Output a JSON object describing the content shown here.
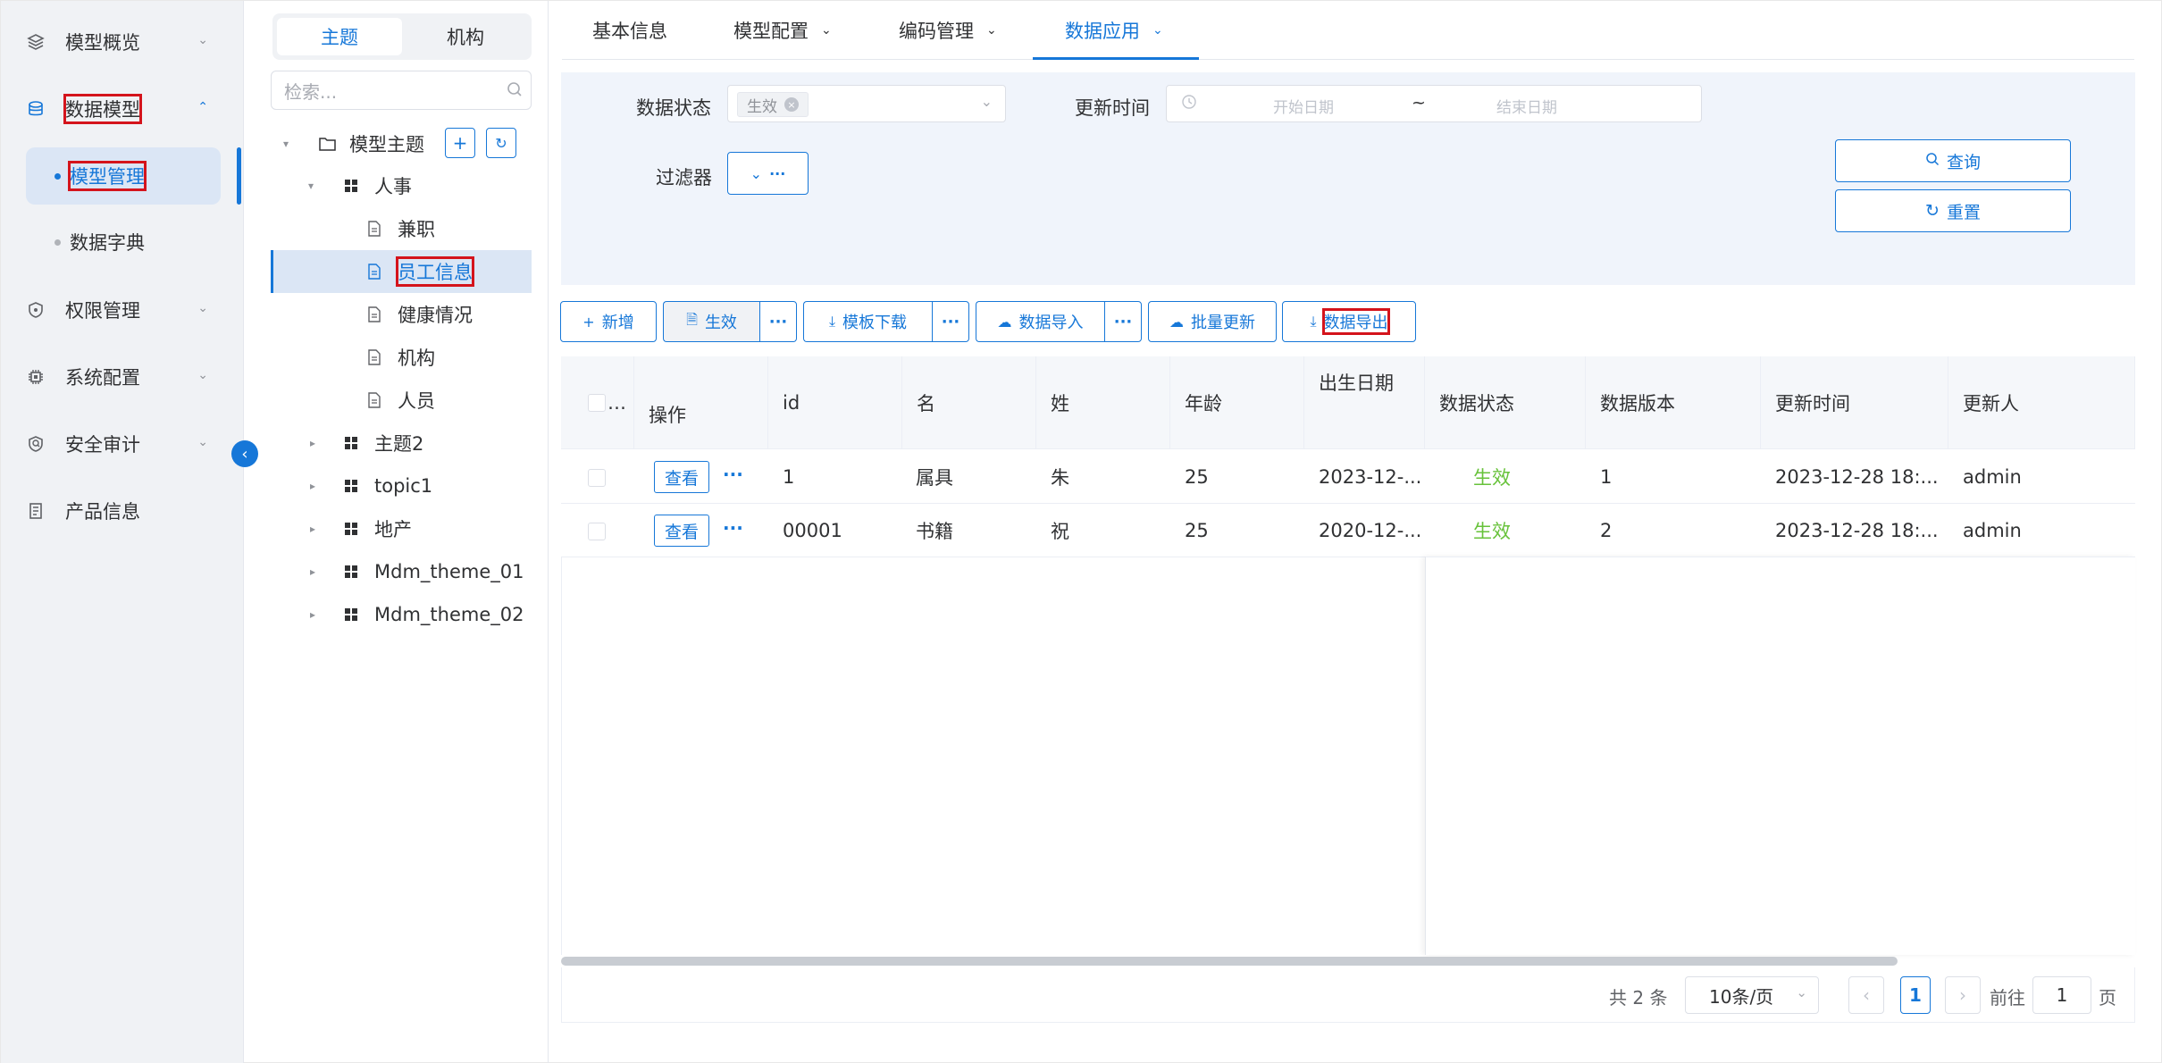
{
  "nav": {
    "items": [
      {
        "label": "模型概览",
        "icon": "layers-icon"
      },
      {
        "label": "数据模型",
        "icon": "database-icon"
      },
      {
        "label": "权限管理",
        "icon": "shield-icon"
      },
      {
        "label": "系统配置",
        "icon": "chip-icon"
      },
      {
        "label": "安全审计",
        "icon": "audit-icon"
      },
      {
        "label": "产品信息",
        "icon": "document-icon"
      }
    ],
    "sub": [
      {
        "label": "模型管理"
      },
      {
        "label": "数据字典"
      }
    ]
  },
  "tree": {
    "seg": [
      "主题",
      "机构"
    ],
    "search_placeholder": "检索...",
    "root": "模型主题",
    "nodes": [
      "人事",
      "兼职",
      "员工信息",
      "健康情况",
      "机构",
      "人员",
      "主题2",
      "topic1",
      "地产",
      "Mdm_theme_01",
      "Mdm_theme_02"
    ]
  },
  "tabs": [
    "基本信息",
    "模型配置",
    "编码管理",
    "数据应用"
  ],
  "filter": {
    "status_label": "数据状态",
    "status_tag": "生效",
    "time_label": "更新时间",
    "start_ph": "开始日期",
    "sep": "~",
    "end_ph": "结束日期",
    "filter_label": "过滤器",
    "query": "查询",
    "reset": "重置"
  },
  "toolbar": {
    "add": "新增",
    "activate": "生效",
    "template": "模板下载",
    "import": "数据导入",
    "batch": "批量更新",
    "export": "数据导出",
    "more": "···"
  },
  "table": {
    "headers": [
      "操作",
      "id",
      "名",
      "姓",
      "年龄",
      "出生日期",
      "数据状态",
      "数据版本",
      "更新时间",
      "更新人"
    ],
    "view": "查看",
    "rows": [
      {
        "id": "1",
        "first": "属具",
        "last": "朱",
        "age": "25",
        "birth": "2023-12-...",
        "status": "生效",
        "version": "1",
        "updated": "2023-12-28 18:...",
        "user": "admin"
      },
      {
        "id": "00001",
        "first": "书籍",
        "last": "祝",
        "age": "25",
        "birth": "2020-12-...",
        "status": "生效",
        "version": "2",
        "updated": "2023-12-28 18:...",
        "user": "admin"
      }
    ]
  },
  "pager": {
    "total": "共 2 条",
    "size": "10条/页",
    "page": "1",
    "goto": "前往",
    "goto_val": "1",
    "unit": "页"
  },
  "colors": {
    "primary": "#1677d8",
    "success": "#67c23a",
    "highlight": "#d4141c"
  }
}
